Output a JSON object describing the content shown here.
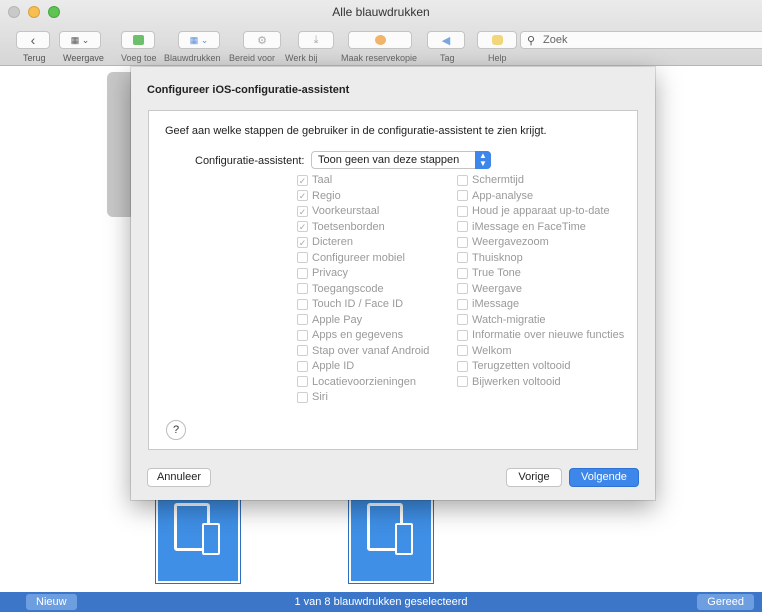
{
  "window": {
    "title": "Alle blauwdrukken"
  },
  "toolbar": {
    "items": [
      {
        "label": "Terug",
        "icon": "chevron-left-icon"
      },
      {
        "label": "Weergave",
        "icon": "view-grid-icon"
      },
      {
        "label": "Voeg toe",
        "icon": "add-icon"
      },
      {
        "label": "Blauwdrukken",
        "icon": "blueprints-icon"
      },
      {
        "label": "Bereid voor",
        "icon": "prepare-icon"
      },
      {
        "label": "Werk bij",
        "icon": "update-icon"
      },
      {
        "label": "Maak reservekopie",
        "icon": "backup-icon"
      },
      {
        "label": "Tag",
        "icon": "tag-icon"
      },
      {
        "label": "Help",
        "icon": "help-icon"
      }
    ],
    "search": {
      "placeholder": "Zoek"
    }
  },
  "sheet": {
    "title": "Configureer iOS-configuratie-assistent",
    "instructions": "Geef aan welke stappen de gebruiker in de configuratie-assistent te zien krijgt.",
    "assistant_label": "Configuratie-assistent:",
    "assistant_value": "Toon geen van deze stappen",
    "left_options": [
      {
        "label": "Taal",
        "checked": true
      },
      {
        "label": "Regio",
        "checked": true
      },
      {
        "label": "Voorkeurstaal",
        "checked": true
      },
      {
        "label": "Toetsenborden",
        "checked": true
      },
      {
        "label": "Dicteren",
        "checked": true
      },
      {
        "label": "Configureer mobiel",
        "checked": false
      },
      {
        "label": "Privacy",
        "checked": false
      },
      {
        "label": "Toegangscode",
        "checked": false
      },
      {
        "label": "Touch ID / Face ID",
        "checked": false
      },
      {
        "label": "Apple Pay",
        "checked": false
      },
      {
        "label": "Apps en gegevens",
        "checked": false
      },
      {
        "label": "Stap over vanaf Android",
        "checked": false
      },
      {
        "label": "Apple ID",
        "checked": false
      },
      {
        "label": "Locatievoorzieningen",
        "checked": false
      },
      {
        "label": "Siri",
        "checked": false
      }
    ],
    "right_options": [
      {
        "label": "Schermtijd",
        "checked": false
      },
      {
        "label": "App-analyse",
        "checked": false
      },
      {
        "label": "Houd je apparaat up-to-date",
        "checked": false
      },
      {
        "label": "iMessage en FaceTime",
        "checked": false
      },
      {
        "label": "Weergavezoom",
        "checked": false
      },
      {
        "label": "Thuisknop",
        "checked": false
      },
      {
        "label": "True Tone",
        "checked": false
      },
      {
        "label": "Weergave",
        "checked": false
      },
      {
        "label": "iMessage",
        "checked": false
      },
      {
        "label": "Watch-migratie",
        "checked": false
      },
      {
        "label": "Informatie over nieuwe functies",
        "checked": false
      },
      {
        "label": "Welkom",
        "checked": false
      },
      {
        "label": "Terugzetten voltooid",
        "checked": false
      },
      {
        "label": "Bijwerken voltooid",
        "checked": false
      }
    ],
    "help_label": "?",
    "cancel_label": "Annuleer",
    "back_label": "Vorige",
    "next_label": "Volgende"
  },
  "statusbar": {
    "new_label": "Nieuw",
    "status_text": "1 van 8 blauwdrukken geselecteerd",
    "done_label": "Gereed"
  },
  "colors": {
    "accent": "#3d86ea",
    "statusbar": "#3b76c9",
    "blueprint": "#3f8fe6"
  }
}
